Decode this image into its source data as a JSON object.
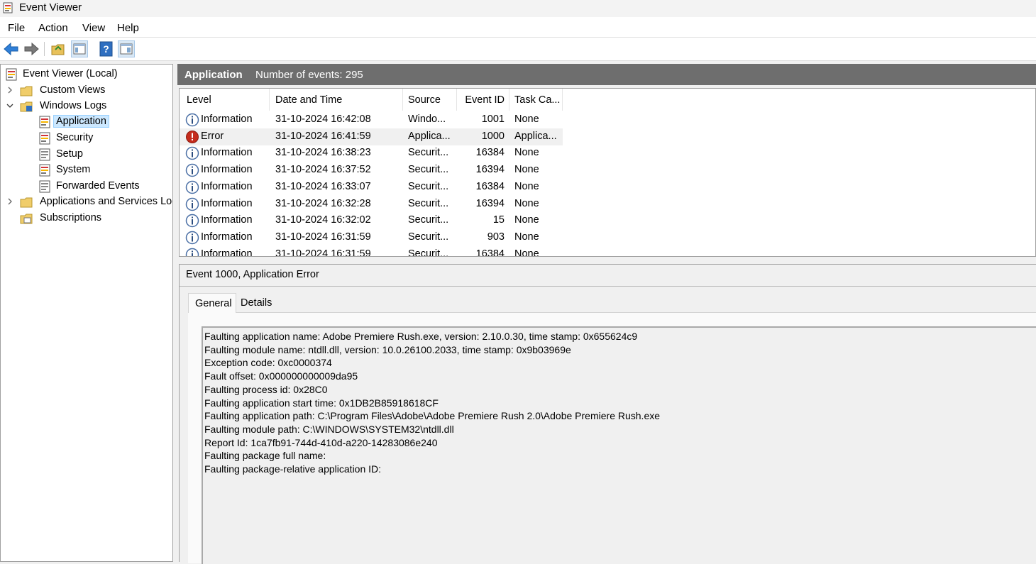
{
  "window": {
    "title": "Event Viewer"
  },
  "menu": [
    "File",
    "Action",
    "View",
    "Help"
  ],
  "toolbar": {
    "icons": [
      "back-arrow-icon",
      "forward-arrow-icon",
      "open-folder-icon",
      "show-hide-tree-icon",
      "help-icon",
      "properties-pane-icon"
    ]
  },
  "tree": {
    "root": "Event Viewer (Local)",
    "custom_views": "Custom Views",
    "windows_logs": "Windows Logs",
    "windows_logs_children": [
      "Application",
      "Security",
      "Setup",
      "System",
      "Forwarded Events"
    ],
    "apps_services": "Applications and Services Logs",
    "subscriptions": "Subscriptions",
    "selected": "Application"
  },
  "log_header": {
    "title": "Application",
    "count_text": "Number of events: 295"
  },
  "events_table": {
    "columns": [
      "Level",
      "Date and Time",
      "Source",
      "Event ID",
      "Task Ca..."
    ],
    "rows": [
      {
        "level": "Information",
        "datetime": "31-10-2024 16:42:08",
        "source": "Windo...",
        "event_id": "1001",
        "task": "None"
      },
      {
        "level": "Error",
        "datetime": "31-10-2024 16:41:59",
        "source": "Applica...",
        "event_id": "1000",
        "task": "Applica..."
      },
      {
        "level": "Information",
        "datetime": "31-10-2024 16:38:23",
        "source": "Securit...",
        "event_id": "16384",
        "task": "None"
      },
      {
        "level": "Information",
        "datetime": "31-10-2024 16:37:52",
        "source": "Securit...",
        "event_id": "16394",
        "task": "None"
      },
      {
        "level": "Information",
        "datetime": "31-10-2024 16:33:07",
        "source": "Securit...",
        "event_id": "16384",
        "task": "None"
      },
      {
        "level": "Information",
        "datetime": "31-10-2024 16:32:28",
        "source": "Securit...",
        "event_id": "16394",
        "task": "None"
      },
      {
        "level": "Information",
        "datetime": "31-10-2024 16:32:02",
        "source": "Securit...",
        "event_id": "15",
        "task": "None"
      },
      {
        "level": "Information",
        "datetime": "31-10-2024 16:31:59",
        "source": "Securit...",
        "event_id": "903",
        "task": "None"
      },
      {
        "level": "Information",
        "datetime": "31-10-2024 16:31:59",
        "source": "Securit...",
        "event_id": "16384",
        "task": "None"
      }
    ]
  },
  "detail": {
    "title": "Event 1000, Application Error",
    "tabs": [
      "General",
      "Details"
    ],
    "active_tab": "General",
    "lines": [
      "Faulting application name: Adobe Premiere Rush.exe, version: 2.10.0.30, time stamp: 0x655624c9",
      "Faulting module name: ntdll.dll, version: 10.0.26100.2033, time stamp: 0x9b03969e",
      "Exception code: 0xc0000374",
      "Fault offset: 0x000000000009da95",
      "Faulting process id: 0x28C0",
      "Faulting application start time: 0x1DB2B85918618CF",
      "Faulting application path: C:\\Program Files\\Adobe\\Adobe Premiere Rush 2.0\\Adobe Premiere Rush.exe",
      "Faulting module path: C:\\WINDOWS\\SYSTEM32\\ntdll.dll",
      "Report Id: 1ca7fb91-744d-410d-a220-14283086e240",
      "Faulting package full name: ",
      "Faulting package-relative application ID: "
    ]
  },
  "colors": {
    "selection": "#cce8ff",
    "header_bar": "#6e6e6e",
    "error_red": "#c42b1c",
    "info_blue": "#4a6fa5"
  }
}
